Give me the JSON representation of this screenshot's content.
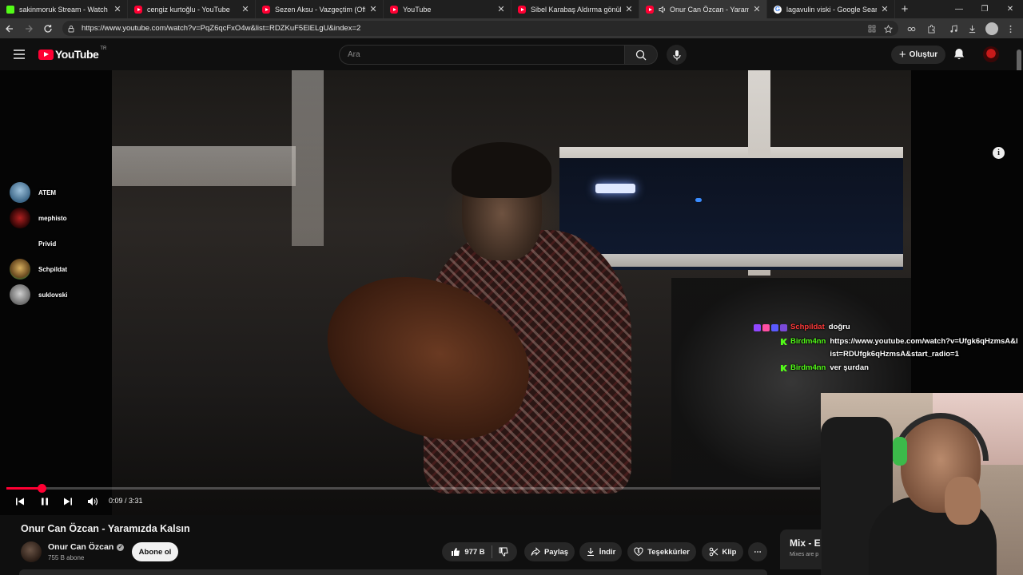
{
  "browser": {
    "tabs": [
      {
        "label": "sakinmoruk Stream - Watch Live on",
        "favicon": "kick-icon",
        "active": false
      },
      {
        "label": "cengiz kurtoğlu - YouTube",
        "favicon": "youtube-icon",
        "active": false
      },
      {
        "label": "Sezen Aksu - Vazgeçtim (Official Au",
        "favicon": "youtube-icon",
        "active": false
      },
      {
        "label": "YouTube",
        "favicon": "youtube-icon",
        "active": false
      },
      {
        "label": "Sibel Karabaş Aldırma gönül Aldırma",
        "favicon": "youtube-icon",
        "active": false
      },
      {
        "label": "Onur Can Özcan - Yaramızda Kal",
        "favicon": "youtube-icon",
        "active": true,
        "audio": true
      },
      {
        "label": "lagavulin viski - Google Search",
        "favicon": "google-icon",
        "active": false
      }
    ],
    "new_tab": "+",
    "url": "https://www.youtube.com/watch?v=PqZ6qcFxO4w&list=RDZKuF5ElELgU&index=2"
  },
  "youtube": {
    "logo_text": "YouTube",
    "country_code": "TR",
    "search_placeholder": "Ara",
    "create_label": "Oluştur",
    "accent": "#ff0033"
  },
  "stream": {
    "viewers": [
      {
        "name": "ATEM",
        "avatar_color": "#5a86a8"
      },
      {
        "name": "mephisto",
        "avatar_color": "#8a1a1a"
      },
      {
        "name": "Privid",
        "avatar_color": ""
      },
      {
        "name": "Schpildat",
        "avatar_color": "#a08a40"
      },
      {
        "name": "suklovski",
        "avatar_color": "#9a9a9a"
      }
    ],
    "chat": [
      {
        "user": "Schpildat",
        "user_color": "#ff3b3b",
        "text": "doğru",
        "badges": "sub"
      },
      {
        "user": "Birdm4nn",
        "user_color": "#53fc18",
        "text": "https://www.youtube.com/watch?v=Ufgk6qHzmsA&list=RDUfgk6qHzmsA&start_radio=1",
        "badges": "kick"
      },
      {
        "user": "Birdm4nn",
        "user_color": "#53fc18",
        "text": "ver şurdan",
        "badges": "kick"
      }
    ]
  },
  "player": {
    "current_time": "0:09",
    "duration": "3:31",
    "timecode": "0:09 / 3:31",
    "progress_fraction": 0.043
  },
  "video": {
    "title": "Onur Can Özcan - Yaramızda Kalsın",
    "channel": "Onur Can Özcan",
    "subscribers": "755 B abone",
    "subscribe_label": "Abone ol",
    "likes": "977 B",
    "share_label": "Paylaş",
    "download_label": "İndir",
    "thanks_label": "Teşekkürler",
    "clip_label": "Klip",
    "more_label": "⋯"
  },
  "mix": {
    "title": "Mix - E",
    "subtitle": "Mixes are p"
  }
}
